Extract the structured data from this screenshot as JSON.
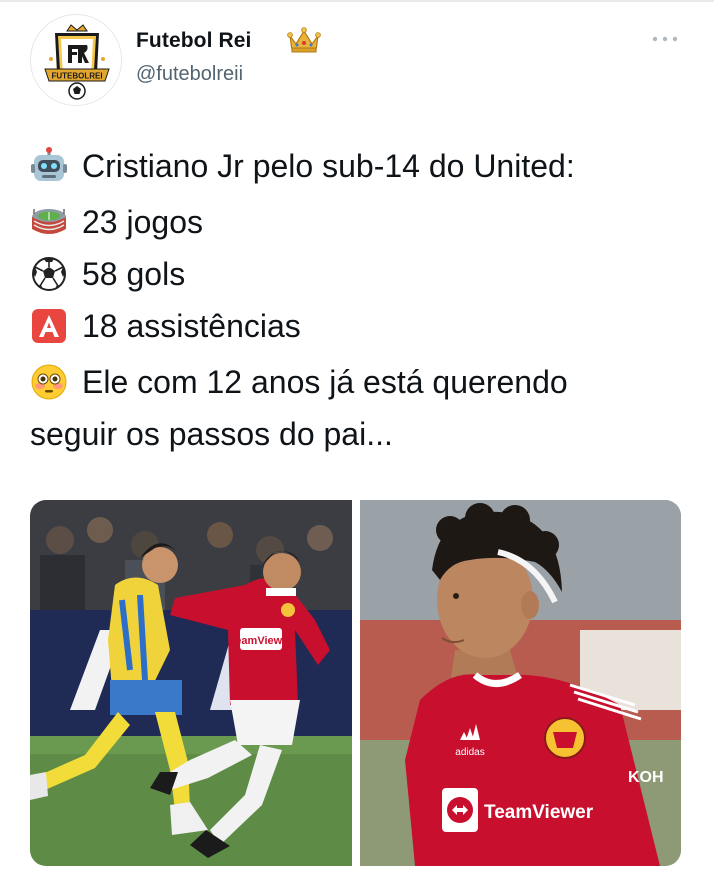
{
  "author": {
    "name": "Futebol Rei",
    "handle": "@futebolreii",
    "avatar_label": "FUTEBOLREI",
    "avatar_monogram": "FR",
    "verified_icon": "crown-icon"
  },
  "header": {
    "more_icon": "more-dots-icon"
  },
  "tweet": {
    "lines": [
      {
        "emoji": "robot-emoji",
        "text": "Cristiano Jr pelo sub-14 do United:"
      },
      {
        "emoji": "stadium-emoji",
        "text": "23 jogos"
      },
      {
        "emoji": "soccer-ball-emoji",
        "text": "58 gols"
      },
      {
        "emoji": "letter-a-button-emoji",
        "text": "18 assistências"
      },
      {
        "emoji": "flushed-face-emoji",
        "text": "Ele com 12 anos já está querendo"
      },
      {
        "emoji": "",
        "text": "seguir os passos do pai..."
      }
    ]
  },
  "media": {
    "photos": [
      {
        "name": "photo-match-action",
        "jersey_sponsor": "TeamViewer"
      },
      {
        "name": "photo-portrait",
        "jersey_sponsor": "TeamViewer",
        "jersey_brand": "adidas",
        "sleeve_sponsor": "KOH"
      }
    ]
  },
  "colors": {
    "text": "#0f1419",
    "secondary_text": "#536471",
    "united_red": "#c8102e",
    "crown_gold": "#e3a72f"
  }
}
